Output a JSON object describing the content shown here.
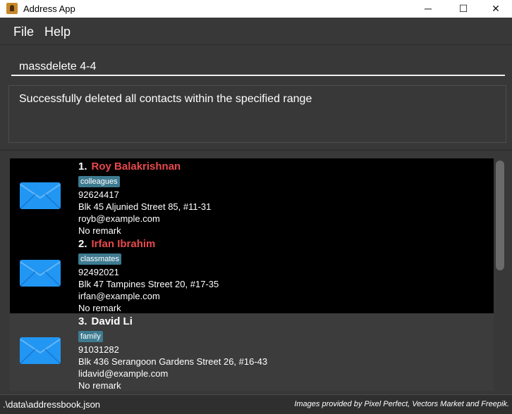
{
  "window": {
    "title": "Address App",
    "minimize_glyph": "─",
    "maximize_glyph": "☐",
    "close_glyph": "✕"
  },
  "menu": {
    "file": "File",
    "help": "Help"
  },
  "command": {
    "value": "massdelete 4-4"
  },
  "result": {
    "message": "Successfully deleted all contacts within the specified range"
  },
  "contacts": [
    {
      "index": "1.",
      "name": "Roy Balakrishnan",
      "tag": "colleagues",
      "phone": "92624417",
      "address": "Blk 45 Aljunied Street 85, #11-31",
      "email": "royb@example.com",
      "remark": "No remark",
      "name_color": "#e8484b",
      "icon": "envelope-icon"
    },
    {
      "index": "2.",
      "name": "Irfan Ibrahim",
      "tag": "classmates",
      "phone": "92492021",
      "address": "Blk 47 Tampines Street 20, #17-35",
      "email": "irfan@example.com",
      "remark": "No remark",
      "name_color": "#e8484b",
      "icon": "envelope-icon"
    },
    {
      "index": "3.",
      "name": "David Li",
      "tag": "family",
      "phone": "91031282",
      "address": "Blk 436 Serangoon Gardens Street 26, #16-43",
      "email": "lidavid@example.com",
      "remark": "No remark",
      "name_color": "#ffffff",
      "icon": "envelope-icon"
    }
  ],
  "status": {
    "file_path": ".\\data\\addressbook.json",
    "credits": "Images provided by Pixel Perfect, Vectors Market and Freepik."
  },
  "colors": {
    "background": "#383838",
    "tag": "#3e7b91",
    "highlight_name": "#e8484b",
    "envelope": "#2196f3"
  }
}
